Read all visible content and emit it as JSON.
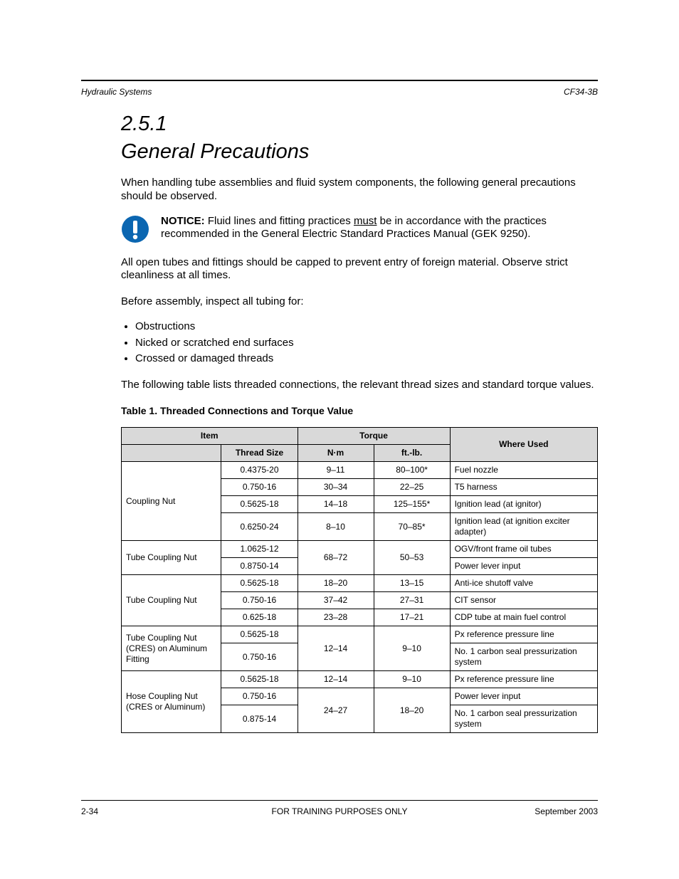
{
  "header": {
    "left": "Hydraulic Systems",
    "right": "CF34-3B"
  },
  "section": {
    "number": "2.5.1",
    "title": "General Precautions"
  },
  "intro": "When handling tube assemblies and fluid system components, the following general precautions should be observed.",
  "notice": {
    "label": "NOTICE:",
    "text_before": "Fluid lines and fitting practices ",
    "must": "must",
    "text_after": " be in accordance with the practices recommended in the General Electric Standard Practices Manual (GEK 9250)."
  },
  "after_notice": "All open tubes and fittings should be capped to prevent entry of foreign material. Observe strict cleanliness at all times.",
  "bullets_intro": "Before assembly, inspect all tubing for:",
  "bullets": [
    "Obstructions",
    "Nicked or scratched end surfaces",
    "Crossed or damaged threads"
  ],
  "before_table": "The following table lists threaded connections, the relevant thread sizes and standard torque values.",
  "table_caption": "Table 1. Threaded Connections and Torque Value",
  "table": {
    "head": {
      "item": "Item",
      "torque": "Torque",
      "use": "Where Used",
      "thread": "Thread Size",
      "nm": "N·m",
      "ftlb": "ft.-lb."
    },
    "rows": [
      {
        "item": "Coupling Nut",
        "item_rowspan": 4,
        "thread": "0.4375-20",
        "nm": "9–11",
        "ftlb": "80–100*",
        "use": "Fuel nozzle"
      },
      {
        "thread": "0.750-16",
        "nm": "30–34",
        "ftlb": "22–25",
        "use": "T5 harness"
      },
      {
        "thread": "0.5625-18",
        "nm": "14–18",
        "ftlb": "125–155*",
        "use": "Ignition lead (at ignitor)"
      },
      {
        "thread": "0.6250-24",
        "nm": "8–10",
        "ftlb": "70–85*",
        "use": "Ignition lead (at ignition exciter adapter)"
      },
      {
        "item": "Tube Coupling Nut",
        "item_rowspan": 2,
        "thread": "1.0625-12",
        "nm": "68–72",
        "nm_rowspan": 2,
        "ftlb": "50–53",
        "ftlb_rowspan": 2,
        "use": "OGV/front frame oil tubes"
      },
      {
        "thread": "0.8750-14",
        "use": "Power lever input"
      },
      {
        "item": "Tube Coupling Nut",
        "item_rowspan": 3,
        "thread": "0.5625-18",
        "nm": "18–20",
        "ftlb": "13–15",
        "use": "Anti-ice shutoff valve"
      },
      {
        "thread": "0.750-16",
        "nm": "37–42",
        "ftlb": "27–31",
        "use": "CIT sensor"
      },
      {
        "thread": "0.625-18",
        "nm": "23–28",
        "ftlb": "17–21",
        "use": "CDP tube at main fuel control"
      },
      {
        "item": "Tube Coupling Nut (CRES) on Aluminum Fitting",
        "item_rowspan": 2,
        "thread": "0.5625-18",
        "nm": "12–14",
        "nm_rowspan": 2,
        "ftlb": "9–10",
        "ftlb_rowspan": 2,
        "use": "Px reference pressure line"
      },
      {
        "thread": "0.750-16",
        "use": "No. 1 carbon seal pressurization system"
      },
      {
        "item": "Hose Coupling Nut (CRES or Aluminum)",
        "item_rowspan": 3,
        "thread": "0.5625-18",
        "nm": "12–14",
        "ftlb": "9–10",
        "use": "Px reference pressure line"
      },
      {
        "thread": "0.750-16",
        "nm": "24–27",
        "nm_rowspan": 2,
        "ftlb": "18–20",
        "ftlb_rowspan": 2,
        "use": "Power lever input"
      },
      {
        "thread": "0.875-14",
        "use": "No. 1 carbon seal pressurization system"
      }
    ]
  },
  "footer": {
    "left": "2-34",
    "center": "FOR TRAINING PURPOSES ONLY",
    "right": "September 2003"
  }
}
